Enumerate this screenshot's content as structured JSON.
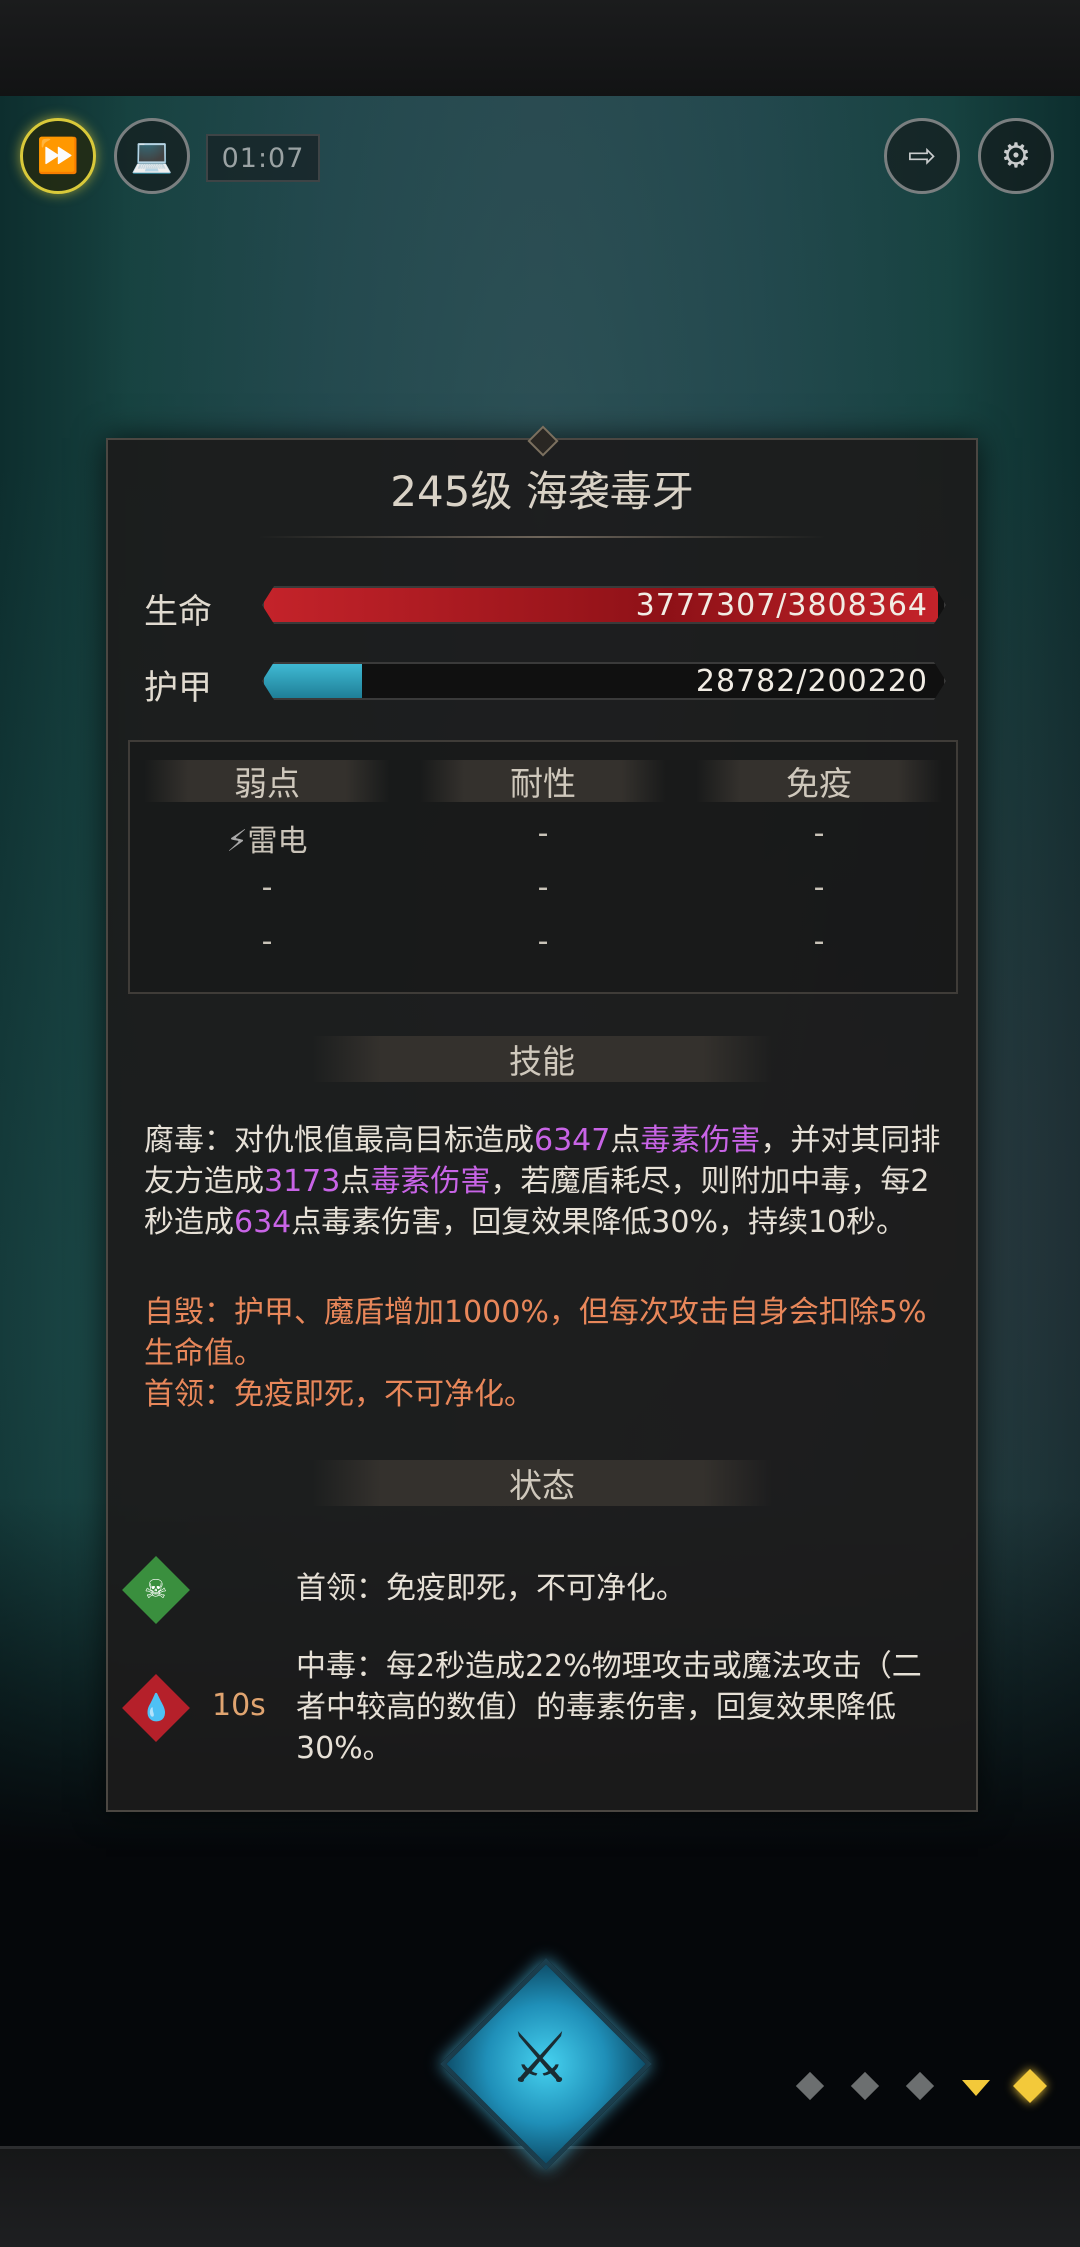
{
  "hud": {
    "fast_forward_icon": "fast-forward-icon",
    "auto_icon": "auto-battle-icon",
    "timer": "01:07",
    "exit_icon": "exit-door-icon",
    "settings_icon": "gear-icon"
  },
  "panel": {
    "title": "245级  海袭毒牙",
    "hp": {
      "label": "生命",
      "current": 3777307,
      "max": 3808364,
      "text": "3777307/3808364",
      "color": "#c4232a"
    },
    "armor": {
      "label": "护甲",
      "current": 28782,
      "max": 200220,
      "text": "28782/200220",
      "color": "#3fb9d3"
    },
    "resistances": {
      "headers": [
        "弱点",
        "耐性",
        "免疫"
      ],
      "rows": [
        [
          "雷电",
          "-",
          "-"
        ],
        [
          "-",
          "-",
          "-"
        ],
        [
          "-",
          "-",
          "-"
        ]
      ]
    },
    "skills": {
      "header": "技能",
      "skill1": {
        "p1": "腐毒：对仇恨值最高目标造成",
        "v1": "6347",
        "p2": "点",
        "t1": "毒素伤害",
        "p3": "，并对其同排友方造成",
        "v2": "3173",
        "p4": "点",
        "t2": "毒素伤害",
        "p5": "，若魔盾耗尽，则附加中毒，每2秒造成",
        "v3": "634",
        "p6": "点毒素伤害，回复效果降低30%，持续10秒。"
      },
      "skill2": "自毁：护甲、魔盾增加1000%，但每次攻击自身会扣除5%生命值。",
      "skill3": "首领：免疫即死，不可净化。"
    },
    "status": {
      "header": "状态",
      "items": [
        {
          "icon": "skull-icon",
          "duration": "",
          "text": "首领：免疫即死，不可净化。",
          "color": "#3a8f3e"
        },
        {
          "icon": "poison-drops-icon",
          "duration": "10s",
          "text": "中毒：每2秒造成22%物理攻击或魔法攻击（二者中较高的数值）的毒素伤害，回复效果降低30%。",
          "color": "#b5202a"
        }
      ]
    }
  },
  "bottom": {
    "center_icon": "crossed-swords-icon",
    "page_count": 5,
    "active_page": 5
  }
}
